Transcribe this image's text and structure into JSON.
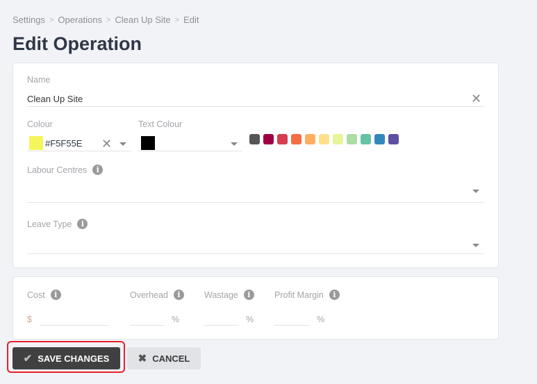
{
  "breadcrumb": [
    "Settings",
    "Operations",
    "Clean Up Site",
    "Edit"
  ],
  "title": "Edit Operation",
  "form": {
    "name_label": "Name",
    "name_value": "Clean Up Site",
    "colour_label": "Colour",
    "colour_value": "#F5F55E",
    "colour_swatch": "#f5f55e",
    "text_colour_label": "Text Colour",
    "text_colour_swatch": "#000000",
    "palette": [
      "#555555",
      "#9e0142",
      "#d53e4f",
      "#f46d43",
      "#fdae61",
      "#fee08b",
      "#e6f598",
      "#abdda4",
      "#66c2a5",
      "#3288bd",
      "#5e4fa2"
    ],
    "labour_centres_label": "Labour Centres",
    "leave_type_label": "Leave Type"
  },
  "costs": {
    "cost_label": "Cost",
    "currency": "$",
    "overhead_label": "Overhead",
    "wastage_label": "Wastage",
    "profit_label": "Profit Margin",
    "percent": "%"
  },
  "actions": {
    "save": "SAVE CHANGES",
    "cancel": "CANCEL"
  }
}
